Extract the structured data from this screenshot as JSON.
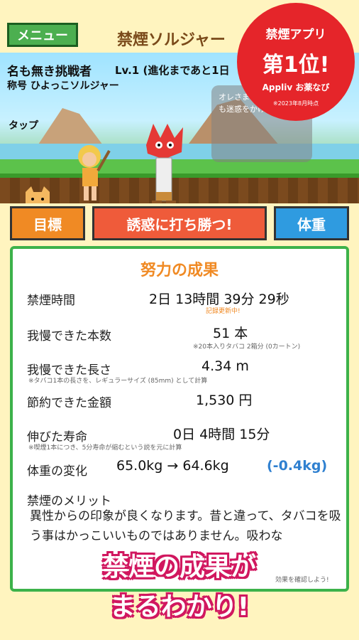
{
  "header": {
    "menu_label": "メニュー",
    "app_title": "禁煙ソルジャー"
  },
  "player": {
    "name": "名も無き挑戦者",
    "level": "Lv.1 (進化まであと1日",
    "title": "称号 ひよっこソルジャー"
  },
  "scene": {
    "speech": "オレさまにこうげきしにも迷惑をかけてるぜ!",
    "tap_label": "タップ"
  },
  "badge": {
    "line1": "禁煙アプリ",
    "line2": "第1位!",
    "line3": "Appliv お薬なび",
    "line4": "※2023年8月時点"
  },
  "tabs": {
    "goal": "目標",
    "resist": "誘惑に打ち勝つ!",
    "weight": "体重"
  },
  "results": {
    "title": "努力の成果",
    "rows": [
      {
        "label": "禁煙時間",
        "value": "2日 13時間 39分 29秒",
        "note": "記録更新中!"
      },
      {
        "label": "我慢できた本数",
        "value": "51 本",
        "note": "※20本入りタバコ 2箱分 (0カートン)"
      },
      {
        "label": "我慢できた長さ",
        "value": "4.34 m",
        "note": "※タバコ1本の長さを、レギュラーサイズ (85mm) として計算"
      },
      {
        "label": "節約できた金額",
        "value": "1,530 円",
        "note": ""
      },
      {
        "label": "伸びた寿命",
        "value": "0日 4時間 15分",
        "note": "※喫煙1本につき、5分寿命が縮むという説を元に計算"
      },
      {
        "label": "体重の変化",
        "value": "65.0kg → 64.6kg",
        "delta": "(-0.4kg)",
        "note": ""
      }
    ],
    "merit_title": "禁煙のメリット",
    "merit_text": "異性からの印象が良くなります。昔と違って、タバコを吸う事はかっこいいものではありません。吸わな",
    "confirm_note": "効果を確認しよう!"
  },
  "overlay": {
    "line1": "禁煙の成果が",
    "line2": "まるわかり!"
  },
  "colors": {
    "accent_orange": "#f08a24",
    "resist_red": "#ef5b3a",
    "weight_blue": "#2f9be0",
    "menu_green": "#4caf50",
    "card_border": "#3cb24a",
    "badge_red": "#e5252a",
    "overlay_pink": "#d1175f"
  }
}
